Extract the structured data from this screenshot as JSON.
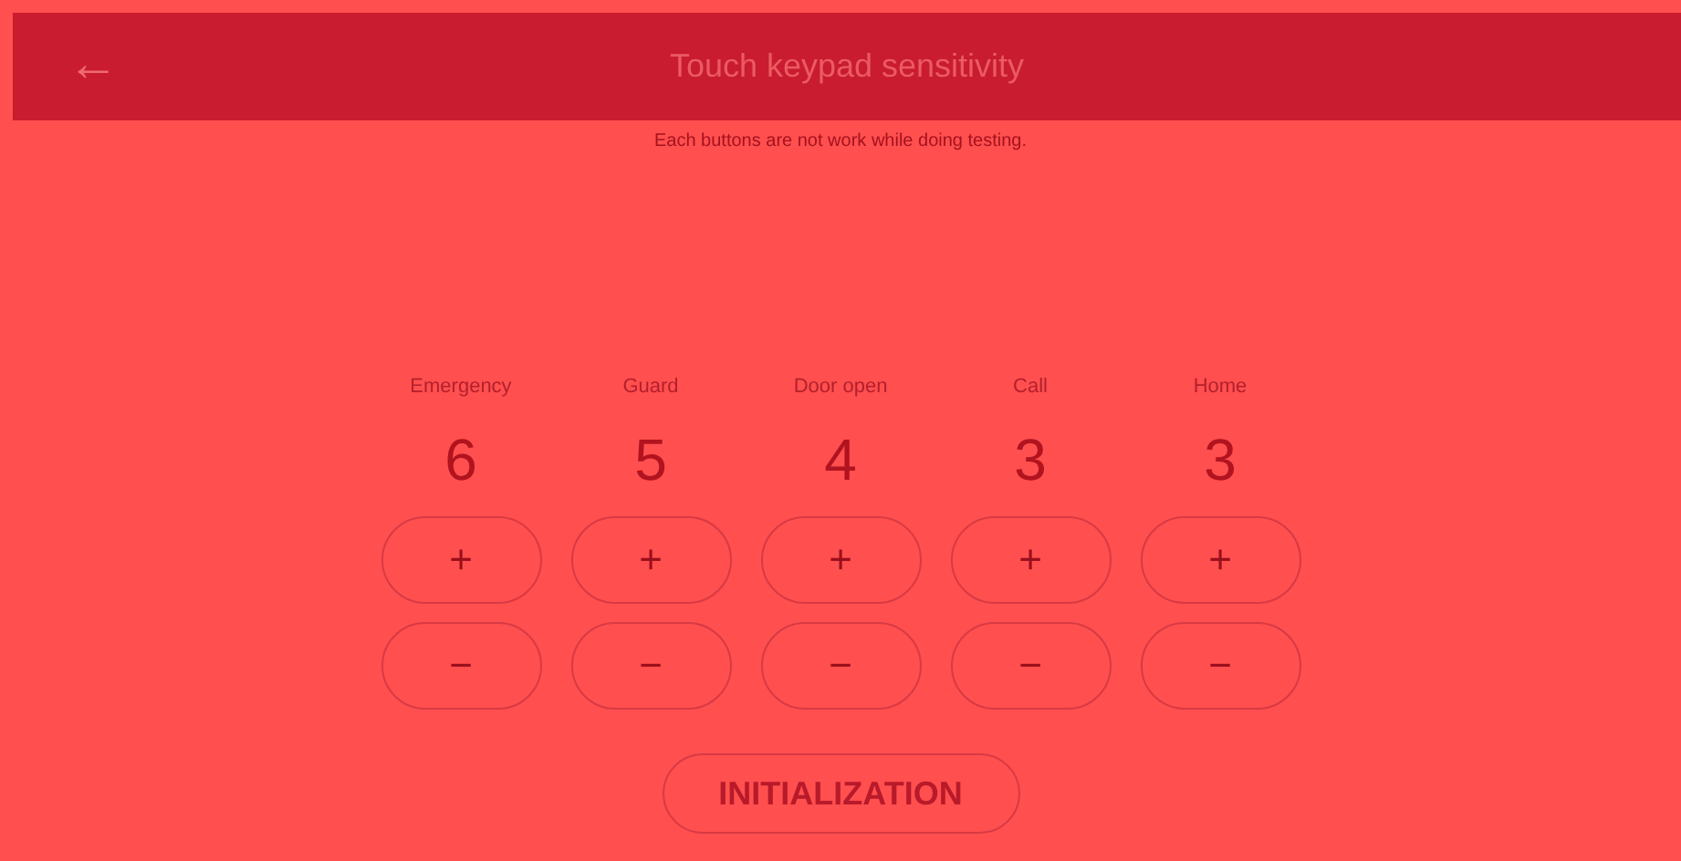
{
  "header": {
    "back": "←",
    "title": "Touch keypad sensitivity"
  },
  "notice": "Each buttons are not work while doing testing.",
  "keys": [
    {
      "label": "Emergency",
      "value": "6",
      "plus": "+",
      "minus": "−"
    },
    {
      "label": "Guard",
      "value": "5",
      "plus": "+",
      "minus": "−"
    },
    {
      "label": "Door open",
      "value": "4",
      "plus": "+",
      "minus": "−"
    },
    {
      "label": "Call",
      "value": "3",
      "plus": "+",
      "minus": "−"
    },
    {
      "label": "Home",
      "value": "3",
      "plus": "+",
      "minus": "−"
    }
  ],
  "reset_button": "INITIALIZATION"
}
